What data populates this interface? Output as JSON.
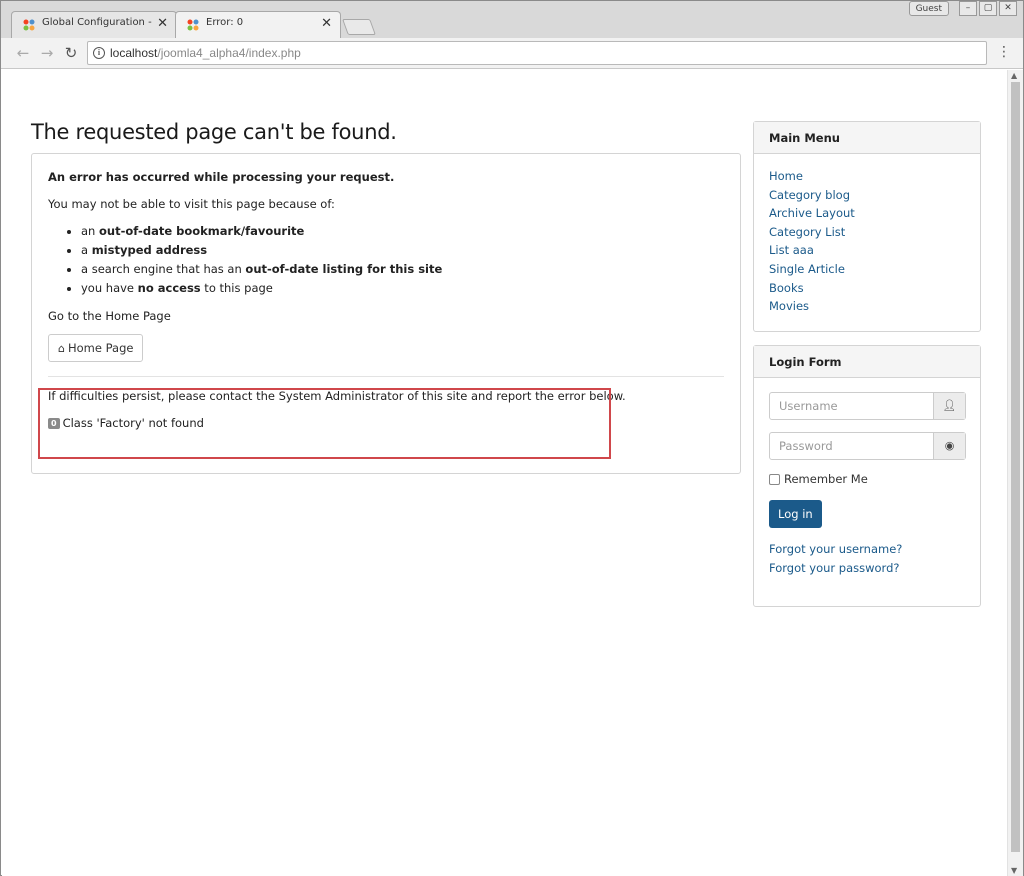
{
  "browser": {
    "tabs": [
      {
        "title": "Global Configuration - Joom"
      },
      {
        "title": "Error: 0"
      }
    ],
    "user_badge": "Guest",
    "url_host": "localhost",
    "url_path": "/joomla4_alpha4/index.php"
  },
  "page": {
    "heading": "The requested page can't be found.",
    "error_intro": "An error has occurred while processing your request.",
    "reasons_intro": "You may not be able to visit this page because of:",
    "reasons": [
      {
        "prefix": "an ",
        "bold": "out-of-date bookmark/favourite",
        "suffix": ""
      },
      {
        "prefix": "a ",
        "bold": "mistyped address",
        "suffix": ""
      },
      {
        "prefix": "a search engine that has an ",
        "bold": "out-of-date listing for this site",
        "suffix": ""
      },
      {
        "prefix": "you have ",
        "bold": "no access",
        "suffix": " to this page"
      }
    ],
    "go_home_text": "Go to the Home Page",
    "home_button": "Home Page",
    "persist_text": "If difficulties persist, please contact the System Administrator of this site and report the error below.",
    "error_code": "0",
    "error_message": "Class 'Factory' not found"
  },
  "sidebar": {
    "main_menu_title": "Main Menu",
    "menu_items": [
      "Home",
      "Category blog",
      "Archive Layout",
      "Category List",
      "List aaa",
      "Single Article",
      "Books",
      "Movies"
    ],
    "login_title": "Login Form",
    "username_placeholder": "Username",
    "password_placeholder": "Password",
    "remember_label": "Remember Me",
    "login_button": "Log in",
    "forgot_username": "Forgot your username?",
    "forgot_password": "Forgot your password?"
  },
  "colors": {
    "link": "#1b5a8a",
    "highlight_border": "#d0474b"
  }
}
